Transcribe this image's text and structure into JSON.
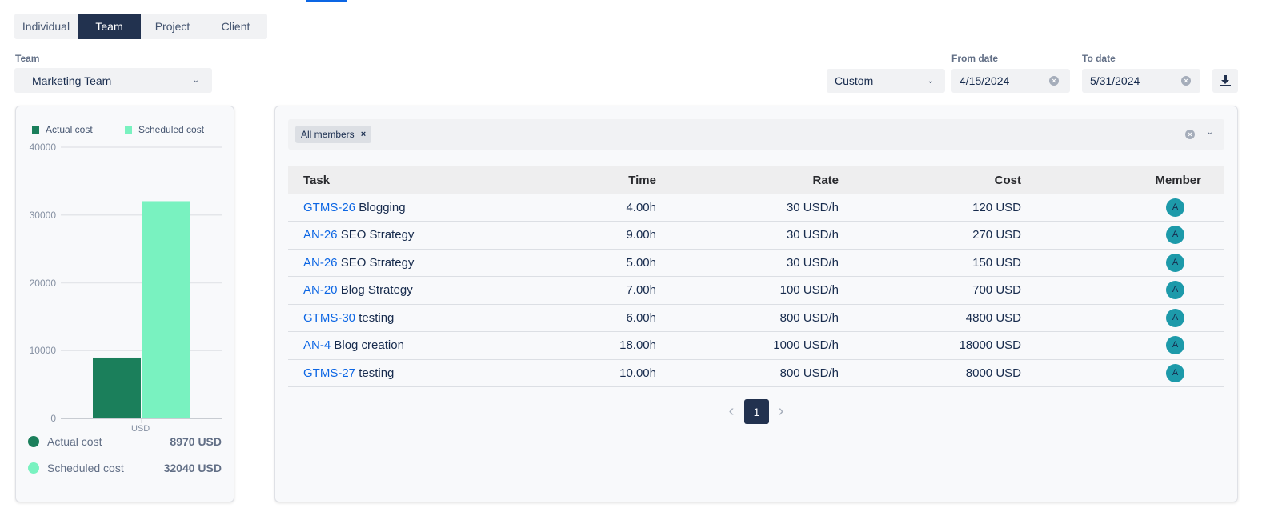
{
  "tabs": [
    {
      "label": "Individual",
      "active": false
    },
    {
      "label": "Team",
      "active": true
    },
    {
      "label": "Project",
      "active": false
    },
    {
      "label": "Client",
      "active": false
    }
  ],
  "team": {
    "label": "Team",
    "value": "Marketing Team"
  },
  "range": {
    "value": "Custom"
  },
  "from_date": {
    "label": "From date",
    "value": "4/15/2024"
  },
  "to_date": {
    "label": "To date",
    "value": "5/31/2024"
  },
  "download_icon": "download-icon",
  "colors": {
    "actual": "#1b7f5b",
    "scheduled": "#79f2c0",
    "accent": "#22324f",
    "link": "#0c66e4",
    "avatar": "#1d9aaa"
  },
  "chart_data": {
    "type": "bar",
    "categories": [
      "USD"
    ],
    "series": [
      {
        "name": "Actual cost",
        "values": [
          8970
        ]
      },
      {
        "name": "Scheduled cost",
        "values": [
          32040
        ]
      }
    ],
    "ylim": [
      0,
      40000
    ],
    "yticks": [
      0,
      10000,
      20000,
      30000,
      40000
    ],
    "grid": true,
    "legend": "top"
  },
  "summary": [
    {
      "label": "Actual cost",
      "value": "8970 USD"
    },
    {
      "label": "Scheduled cost",
      "value": "32040 USD"
    }
  ],
  "filter": {
    "chip": "All members"
  },
  "table": {
    "headers": [
      "Task",
      "Time",
      "Rate",
      "Cost",
      "Member"
    ],
    "rows": [
      {
        "key": "GTMS-26",
        "name": "Blogging",
        "time": "4.00h",
        "rate": "30 USD/h",
        "cost": "120 USD",
        "member": "A"
      },
      {
        "key": "AN-26",
        "name": "SEO Strategy",
        "time": "9.00h",
        "rate": "30 USD/h",
        "cost": "270 USD",
        "member": "A"
      },
      {
        "key": "AN-26",
        "name": "SEO Strategy",
        "time": "5.00h",
        "rate": "30 USD/h",
        "cost": "150 USD",
        "member": "A"
      },
      {
        "key": "AN-20",
        "name": "Blog Strategy",
        "time": "7.00h",
        "rate": "100 USD/h",
        "cost": "700 USD",
        "member": "A"
      },
      {
        "key": "GTMS-30",
        "name": "testing",
        "time": "6.00h",
        "rate": "800 USD/h",
        "cost": "4800 USD",
        "member": "A"
      },
      {
        "key": "AN-4",
        "name": "Blog creation",
        "time": "18.00h",
        "rate": "1000 USD/h",
        "cost": "18000 USD",
        "member": "A"
      },
      {
        "key": "GTMS-27",
        "name": "testing",
        "time": "10.00h",
        "rate": "800 USD/h",
        "cost": "8000 USD",
        "member": "A"
      }
    ]
  },
  "pagination": {
    "current": "1",
    "prev": "‹",
    "next": "›"
  }
}
